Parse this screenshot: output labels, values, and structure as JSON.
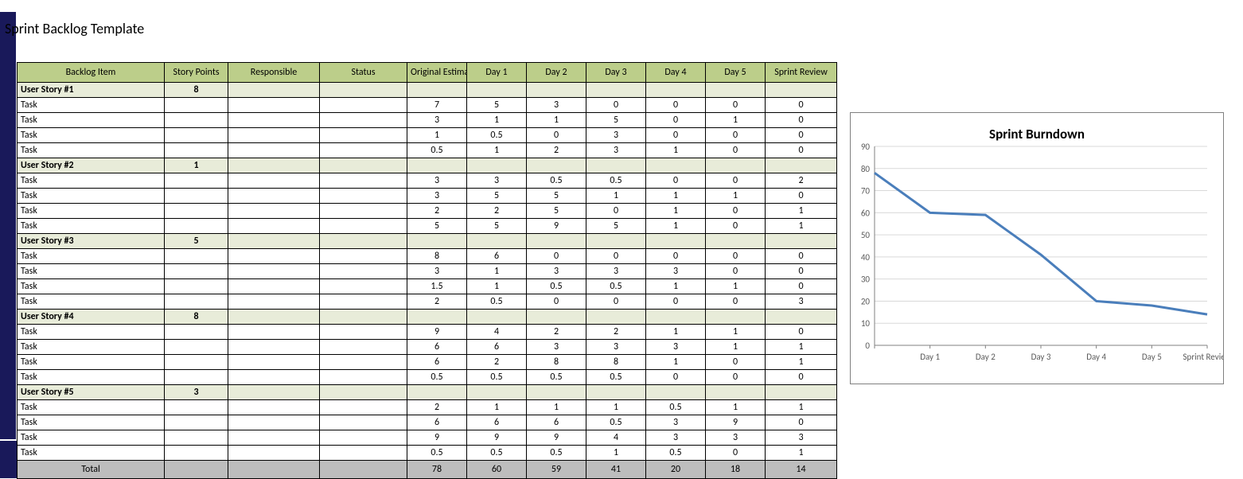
{
  "title": "Sprint Backlog Template",
  "headers": {
    "backlog": "Backlog Item",
    "points": "Story Points",
    "responsible": "Responsible",
    "status": "Status",
    "estimate": "Original Estimate",
    "day1": "Day 1",
    "day2": "Day 2",
    "day3": "Day 3",
    "day4": "Day 4",
    "day5": "Day 5",
    "review": "Sprint Review"
  },
  "stories": [
    {
      "name": "User Story #1",
      "points": 8,
      "tasks": [
        {
          "label": "Task",
          "est": 7,
          "d1": 5,
          "d2": 3,
          "d3": 0,
          "d4": 0,
          "d5": 0,
          "sr": 0
        },
        {
          "label": "Task",
          "est": 3,
          "d1": 1,
          "d2": 1,
          "d3": 5,
          "d4": 0,
          "d5": 1,
          "sr": 0
        },
        {
          "label": "Task",
          "est": 1,
          "d1": 0.5,
          "d2": 0,
          "d3": 3,
          "d4": 0,
          "d5": 0,
          "sr": 0
        },
        {
          "label": "Task",
          "est": 0.5,
          "d1": 1,
          "d2": 2,
          "d3": 3,
          "d4": 1,
          "d5": 0,
          "sr": 0
        }
      ]
    },
    {
      "name": "User Story #2",
      "points": 1,
      "tasks": [
        {
          "label": "Task",
          "est": 3,
          "d1": 3,
          "d2": 0.5,
          "d3": 0.5,
          "d4": 0,
          "d5": 0,
          "sr": 2
        },
        {
          "label": "Task",
          "est": 3,
          "d1": 5,
          "d2": 5,
          "d3": 1,
          "d4": 1,
          "d5": 1,
          "sr": 0
        },
        {
          "label": "Task",
          "est": 2,
          "d1": 2,
          "d2": 5,
          "d3": 0,
          "d4": 1,
          "d5": 0,
          "sr": 1
        },
        {
          "label": "Task",
          "est": 5,
          "d1": 5,
          "d2": 9,
          "d3": 5,
          "d4": 1,
          "d5": 0,
          "sr": 1
        }
      ]
    },
    {
      "name": "User Story #3",
      "points": 5,
      "tasks": [
        {
          "label": "Task",
          "est": 8,
          "d1": 6,
          "d2": 0,
          "d3": 0,
          "d4": 0,
          "d5": 0,
          "sr": 0
        },
        {
          "label": "Task",
          "est": 3,
          "d1": 1,
          "d2": 3,
          "d3": 3,
          "d4": 3,
          "d5": 0,
          "sr": 0
        },
        {
          "label": "Task",
          "est": 1.5,
          "d1": 1,
          "d2": 0.5,
          "d3": 0.5,
          "d4": 1,
          "d5": 1,
          "sr": 0
        },
        {
          "label": "Task",
          "est": 2,
          "d1": 0.5,
          "d2": 0,
          "d3": 0,
          "d4": 0,
          "d5": 0,
          "sr": 3
        }
      ]
    },
    {
      "name": "User Story #4",
      "points": 8,
      "tasks": [
        {
          "label": "Task",
          "est": 9,
          "d1": 4,
          "d2": 2,
          "d3": 2,
          "d4": 1,
          "d5": 1,
          "sr": 0
        },
        {
          "label": "Task",
          "est": 6,
          "d1": 6,
          "d2": 3,
          "d3": 3,
          "d4": 3,
          "d5": 1,
          "sr": 1
        },
        {
          "label": "Task",
          "est": 6,
          "d1": 2,
          "d2": 8,
          "d3": 8,
          "d4": 1,
          "d5": 0,
          "sr": 1
        },
        {
          "label": "Task",
          "est": 0.5,
          "d1": 0.5,
          "d2": 0.5,
          "d3": 0.5,
          "d4": 0,
          "d5": 0,
          "sr": 0
        }
      ]
    },
    {
      "name": "User Story #5",
      "points": 3,
      "tasks": [
        {
          "label": "Task",
          "est": 2,
          "d1": 1,
          "d2": 1,
          "d3": 1,
          "d4": 0.5,
          "d5": 1,
          "sr": 1
        },
        {
          "label": "Task",
          "est": 6,
          "d1": 6,
          "d2": 6,
          "d3": 0.5,
          "d4": 3,
          "d5": 9,
          "sr": 0
        },
        {
          "label": "Task",
          "est": 9,
          "d1": 9,
          "d2": 9,
          "d3": 4,
          "d4": 3,
          "d5": 3,
          "sr": 3
        },
        {
          "label": "Task",
          "est": 0.5,
          "d1": 0.5,
          "d2": 0.5,
          "d3": 1,
          "d4": 0.5,
          "d5": 0,
          "sr": 1
        }
      ]
    }
  ],
  "totals": {
    "label": "Total",
    "est": 78,
    "d1": 60,
    "d2": 59,
    "d3": 41,
    "d4": 20,
    "d5": 18,
    "sr": 14
  },
  "chart_data": {
    "type": "line",
    "title": "Sprint Burndown",
    "categories": [
      "Day 1",
      "Day 2",
      "Day 3",
      "Day 4",
      "Day 5",
      "Sprint Review"
    ],
    "x": [
      0,
      1,
      2,
      3,
      4,
      5,
      6
    ],
    "values": [
      78,
      60,
      59,
      41,
      20,
      18,
      14
    ],
    "ylim": [
      0,
      90
    ],
    "yticks": [
      0,
      10,
      20,
      30,
      40,
      50,
      60,
      70,
      80,
      90
    ],
    "xlabel": "",
    "ylabel": ""
  }
}
